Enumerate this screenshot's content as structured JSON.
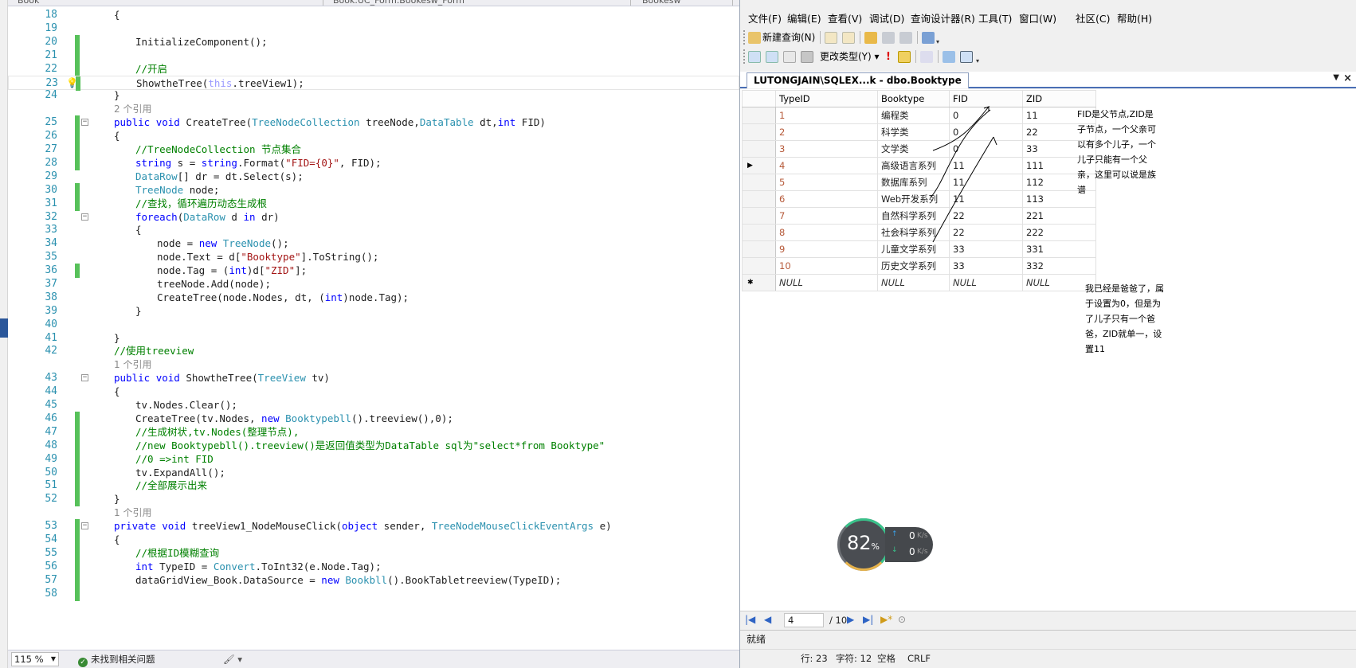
{
  "editor": {
    "tabs": [
      "Book",
      "Book.UC_Form.Bookesw_Form",
      "Bookesw"
    ],
    "lines": [
      {
        "n": "18",
        "code": "{",
        "indent": 1
      },
      {
        "n": "19",
        "code": "",
        "indent": 0
      },
      {
        "n": "20",
        "code": "InitializeComponent();",
        "indent": 2,
        "changed": true
      },
      {
        "n": "21",
        "code": "",
        "indent": 0,
        "changed": true
      },
      {
        "n": "22",
        "code": "//开启",
        "indent": 2,
        "changed": true,
        "comment": true
      },
      {
        "n": "23",
        "code": "ShowtheTree(this.treeView1);",
        "indent": 2,
        "changed": true,
        "current": true
      },
      {
        "n": "24",
        "code": "}",
        "indent": 1
      },
      {
        "ref": "2 个引用"
      },
      {
        "n": "25",
        "code": "public void CreateTree(TreeNodeCollection treeNode,DataTable dt,int FID)",
        "indent": 1,
        "changed": true,
        "fold": true
      },
      {
        "n": "26",
        "code": "{",
        "indent": 1,
        "changed": true
      },
      {
        "n": "27",
        "code": "//TreeNodeCollection 节点集合",
        "indent": 2,
        "changed": true,
        "comment": true
      },
      {
        "n": "28",
        "code": "string s = string.Format(\"FID={0}\", FID);",
        "indent": 2,
        "changed": true
      },
      {
        "n": "29",
        "code": "DataRow[] dr = dt.Select(s);",
        "indent": 2
      },
      {
        "n": "30",
        "code": "TreeNode node;",
        "indent": 2,
        "changed": true
      },
      {
        "n": "31",
        "code": "//查找，循环遍历动态生成根",
        "indent": 2,
        "changed": true,
        "comment": true
      },
      {
        "n": "32",
        "code": "foreach(DataRow d in dr)",
        "indent": 2,
        "fold": true
      },
      {
        "n": "33",
        "code": "{",
        "indent": 2
      },
      {
        "n": "34",
        "code": "node = new TreeNode();",
        "indent": 3
      },
      {
        "n": "35",
        "code": "node.Text = d[\"Booktype\"].ToString();",
        "indent": 3
      },
      {
        "n": "36",
        "code": "node.Tag = (int)d[\"ZID\"];",
        "indent": 3,
        "changed": true
      },
      {
        "n": "37",
        "code": "treeNode.Add(node);",
        "indent": 3
      },
      {
        "n": "38",
        "code": "CreateTree(node.Nodes, dt, (int)node.Tag);",
        "indent": 3
      },
      {
        "n": "39",
        "code": "}",
        "indent": 2
      },
      {
        "n": "40",
        "code": "",
        "indent": 0
      },
      {
        "n": "41",
        "code": "}",
        "indent": 1
      },
      {
        "n": "42",
        "code": "//使用treeview",
        "indent": 1,
        "comment": true
      },
      {
        "ref": "1 个引用"
      },
      {
        "n": "43",
        "code": "public void ShowtheTree(TreeView tv)",
        "indent": 1,
        "fold": true
      },
      {
        "n": "44",
        "code": "{",
        "indent": 1
      },
      {
        "n": "45",
        "code": "tv.Nodes.Clear();",
        "indent": 2
      },
      {
        "n": "46",
        "code": "CreateTree(tv.Nodes, new Booktypebll().treeview(),0);",
        "indent": 2,
        "changed": true
      },
      {
        "n": "47",
        "code": "//生成树状,tv.Nodes(整理节点),",
        "indent": 2,
        "changed": true,
        "comment": true
      },
      {
        "n": "48",
        "code": "//new Booktypebll().treeview()是返回值类型为DataTable sql为\"select*from Booktype\"",
        "indent": 2,
        "changed": true,
        "comment": true
      },
      {
        "n": "49",
        "code": "//0 =>int FID",
        "indent": 2,
        "changed": true,
        "comment": true
      },
      {
        "n": "50",
        "code": "tv.ExpandAll();",
        "indent": 2,
        "changed": true
      },
      {
        "n": "51",
        "code": "//全部展示出来",
        "indent": 2,
        "changed": true,
        "comment": true
      },
      {
        "n": "52",
        "code": "}",
        "indent": 1,
        "changed": true
      },
      {
        "ref": "1 个引用"
      },
      {
        "n": "53",
        "code": "private void treeView1_NodeMouseClick(object sender, TreeNodeMouseClickEventArgs e)",
        "indent": 1,
        "changed": true,
        "fold": true
      },
      {
        "n": "54",
        "code": "{",
        "indent": 1,
        "changed": true
      },
      {
        "n": "55",
        "code": "//根据ID模糊查询",
        "indent": 2,
        "changed": true,
        "comment": true
      },
      {
        "n": "56",
        "code": "int TypeID = Convert.ToInt32(e.Node.Tag);",
        "indent": 2,
        "changed": true
      },
      {
        "n": "57",
        "code": "dataGridView_Book.DataSource = new Bookbll().BookTabletreeview(TypeID);",
        "indent": 2,
        "changed": true
      },
      {
        "n": "58",
        "code": "",
        "indent": 0,
        "changed": true
      }
    ],
    "status": {
      "zoom": "115 %",
      "issues": "未找到相关问题",
      "line": "行: 23",
      "char": "字符: 12",
      "spaces": "空格",
      "eol": "CRLF"
    }
  },
  "ssms": {
    "menu": [
      "文件(F)",
      "编辑(E)",
      "查看(V)",
      "调试(D)",
      "查询设计器(R)",
      "工具(T)",
      "窗口(W)",
      "社区(C)",
      "帮助(H)"
    ],
    "toolbar1": {
      "new_query": "新建查询(N)"
    },
    "toolbar2": {
      "change_type": "更改类型(Y)"
    },
    "doc_tab": "LUTONGJAIN\\SQLEX...k - dbo.Booktype",
    "grid": {
      "columns": [
        "TypeID",
        "Booktype",
        "FID",
        "ZID"
      ],
      "rows": [
        [
          "1",
          "编程类",
          "0",
          "11"
        ],
        [
          "2",
          "科学类",
          "0",
          "22"
        ],
        [
          "3",
          "文学类",
          "0",
          "33"
        ],
        [
          "4",
          "高级语言系列",
          "11",
          "111"
        ],
        [
          "5",
          "数据库系列",
          "11",
          "112"
        ],
        [
          "6",
          "Web开发系列",
          "11",
          "113"
        ],
        [
          "7",
          "自然科学系列",
          "22",
          "221"
        ],
        [
          "8",
          "社会科学系列",
          "22",
          "222"
        ],
        [
          "9",
          "儿童文学系列",
          "33",
          "331"
        ],
        [
          "10",
          "历史文学系列",
          "33",
          "332"
        ]
      ],
      "new_row": [
        "NULL",
        "NULL",
        "NULL",
        "NULL"
      ],
      "current_row_index": 3
    },
    "notes": [
      "FID是父节点,ZID是子节点，一个父亲可以有多个儿子，一个儿子只能有一个父亲，这里可以说是族谱",
      "我已经是爸爸了，属于设置为0，但是为了儿子只有一个爸爸，ZID就单一，设置11"
    ],
    "nav": {
      "record": "4",
      "total": "/ 10"
    },
    "status": "就绪"
  },
  "network_widget": {
    "percent": "82",
    "percent_unit": "%",
    "upload": "0",
    "download": "0",
    "unit": "K/s"
  }
}
